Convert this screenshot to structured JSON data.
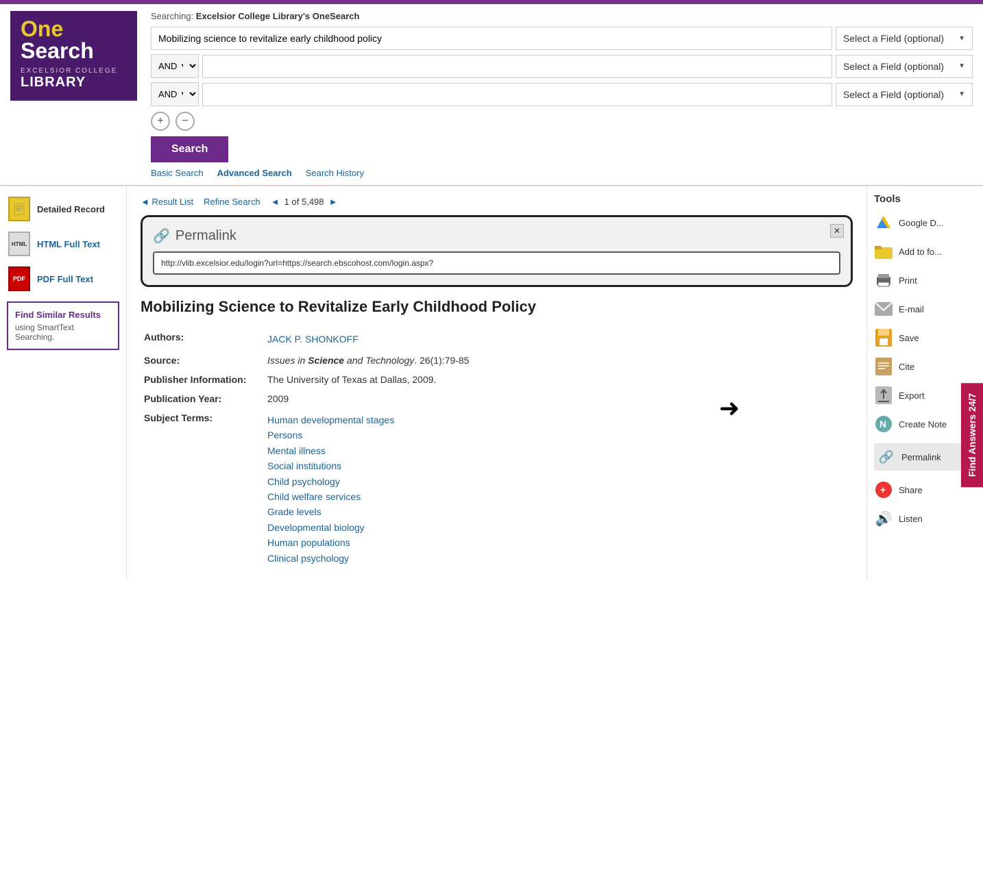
{
  "topbar": {},
  "header": {
    "searching_label": "Searching:",
    "searching_database": "Excelsior College Library's OneSearch",
    "search_query": "Mobilizing science to revitalize early childhood policy",
    "field_placeholder": "Select a Field (optional)",
    "operator1": "AND",
    "operator2": "AND",
    "search_button": "Search",
    "links": {
      "basic": "Basic Search",
      "advanced": "Advanced Search",
      "history": "Search History"
    }
  },
  "logo": {
    "one": "One",
    "search": "Search",
    "excelsior": "EXCELSIOR COLLEGE",
    "library": "LIBRARY"
  },
  "left_sidebar": {
    "detailed_record": "Detailed Record",
    "html_full_text": "HTML Full Text",
    "pdf_full_text": "PDF Full Text",
    "find_similar": "Find Similar Results",
    "find_similar_sub": "using SmartText Searching."
  },
  "result_nav": {
    "result_list": "◄ Result List",
    "refine_search": "Refine Search",
    "current": "1",
    "total": "5,498",
    "prev": "◄",
    "next": "►"
  },
  "permalink_popup": {
    "title": "Permalink",
    "url": "http://vlib.excelsior.edu/login?url=https://search.ebscohost.com/login.aspx?"
  },
  "article": {
    "title": "Mobilizing Science to Revitalize Early Childhood Policy",
    "authors_label": "Authors:",
    "author": "JACK P. SHONKOFF",
    "source_label": "Source:",
    "source": "Issues in Science and Technology. 26(1):79-85",
    "publisher_label": "Publisher Information:",
    "publisher": "The University of Texas at Dallas, 2009.",
    "year_label": "Publication Year:",
    "year": "2009",
    "subject_label": "Subject Terms:",
    "subjects": [
      "Human developmental stages",
      "Persons",
      "Mental illness",
      "Social institutions",
      "Child psychology",
      "Child welfare services",
      "Grade levels",
      "Developmental biology",
      "Human populations",
      "Clinical psychology"
    ]
  },
  "tools": {
    "title": "Tools",
    "items": [
      {
        "id": "google-drive",
        "label": "Google D..."
      },
      {
        "id": "add-folder",
        "label": "Add to fo..."
      },
      {
        "id": "print",
        "label": "Print"
      },
      {
        "id": "email",
        "label": "E-mail"
      },
      {
        "id": "save",
        "label": "Save"
      },
      {
        "id": "cite",
        "label": "Cite"
      },
      {
        "id": "export",
        "label": "Export"
      },
      {
        "id": "create-note",
        "label": "Create Note"
      },
      {
        "id": "permalink",
        "label": "Permalink"
      },
      {
        "id": "share",
        "label": "Share"
      },
      {
        "id": "listen",
        "label": "Listen"
      }
    ]
  },
  "find_answers": "Find Answers 24/7"
}
